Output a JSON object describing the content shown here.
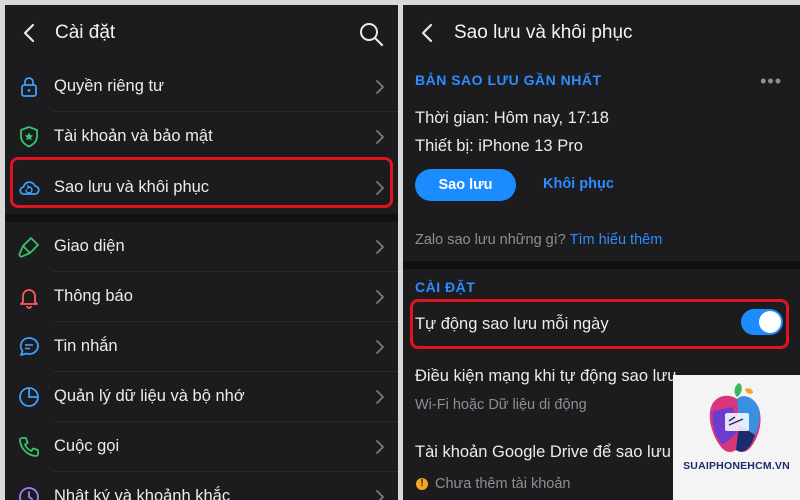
{
  "left": {
    "title": "Cài đặt",
    "items": [
      {
        "label": "Quyền riêng tư"
      },
      {
        "label": "Tài khoản và bảo mật"
      },
      {
        "label": "Sao lưu và khôi phục"
      },
      {
        "label": "Giao diện"
      },
      {
        "label": "Thông báo"
      },
      {
        "label": "Tin nhắn"
      },
      {
        "label": "Quản lý dữ liệu và bộ nhớ"
      },
      {
        "label": "Cuộc gọi"
      },
      {
        "label": "Nhật ký và khoảnh khắc"
      }
    ]
  },
  "right": {
    "title": "Sao lưu và khôi phục",
    "latest_backup_header": "BẢN SAO LƯU GẦN NHẤT",
    "time_label": "Thời gian:",
    "time_value": "Hôm nay, 17:18",
    "device_label": "Thiết bị:",
    "device_value": "iPhone 13 Pro",
    "backup_button": "Sao lưu",
    "restore_button": "Khôi phục",
    "what_backup_text": "Zalo sao lưu những gì?",
    "learn_more": "Tìm hiểu thêm",
    "settings_header": "CÀI ĐẶT",
    "auto_backup_label": "Tự động sao lưu mỗi ngày",
    "auto_backup_on": true,
    "network_label": "Điều kiện mạng khi tự động sao lưu",
    "network_value": "Wi-Fi hoặc Dữ liệu di động",
    "drive_label": "Tài khoản Google Drive để sao lưu ảnh",
    "drive_value": "Chưa thêm tài khoản"
  },
  "watermark": {
    "text": "SUAIPHONEHCM.VN"
  },
  "colors": {
    "background": "#1c1c1e",
    "accent": "#1a8cff",
    "highlight": "#e0141e",
    "warning": "#f5a623"
  }
}
